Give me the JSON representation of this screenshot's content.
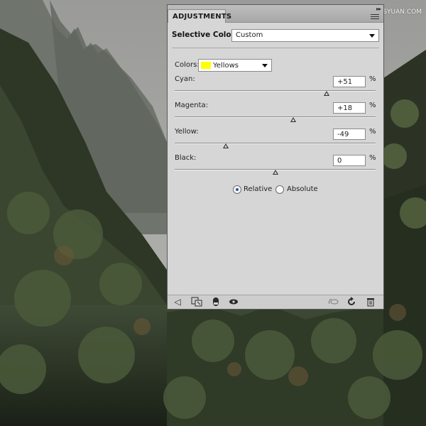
{
  "watermark": "思缘设计论坛 www.MISSYUAN.COM",
  "panel": {
    "tab_title": "ADJUSTMENTS",
    "collapse_icon": "double-chevron-right-icon",
    "menu_icon": "panel-menu-icon"
  },
  "preset": {
    "title": "Selective Color",
    "value": "Custom"
  },
  "colors": {
    "label": "Colors:",
    "value": "Yellows",
    "swatch": "#ffff00"
  },
  "sliders": [
    {
      "label": "Cyan:",
      "value": "+51",
      "unit": "%",
      "level": 51
    },
    {
      "label": "Magenta:",
      "value": "+18",
      "unit": "%",
      "level": 18
    },
    {
      "label": "Yellow:",
      "value": "-49",
      "unit": "%",
      "level": -49
    },
    {
      "label": "Black:",
      "value": "0",
      "unit": "%",
      "level": 0
    }
  ],
  "method": {
    "options": [
      "Relative",
      "Absolute"
    ],
    "selected": "Relative"
  },
  "footer_icons": [
    "back-arrow-icon",
    "clip-to-layer-icon",
    "layer-mask-icon",
    "visibility-eye-icon",
    "view-previous-state-icon",
    "reset-icon",
    "trash-icon"
  ]
}
